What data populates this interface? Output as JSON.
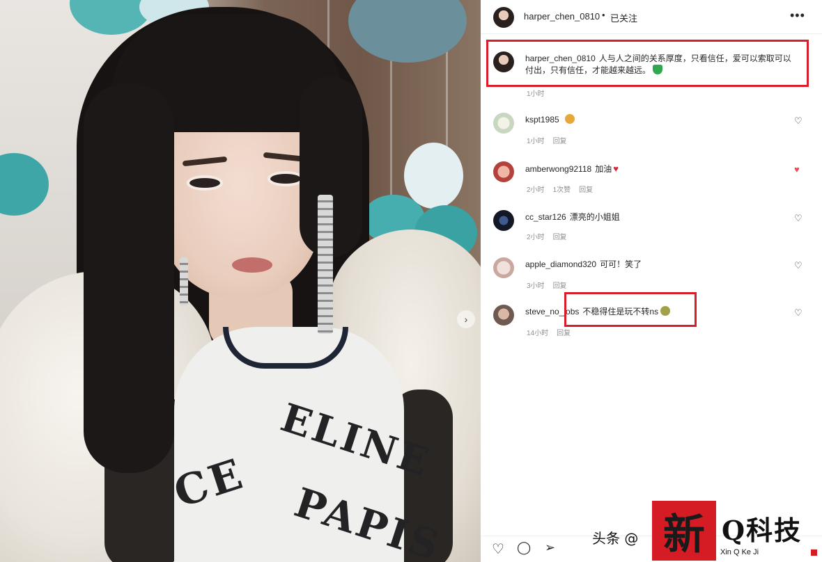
{
  "post": {
    "username": "harper_chen_0810",
    "dot": "•",
    "follow_status": "已关注",
    "more_icon": "more-horizontal-icon",
    "caption_text": "人与人之间的关系厚度，只看信任，爱可以索取可以付出，只有信任，才能越来越远。",
    "caption_time": "1小时"
  },
  "comments": [
    {
      "user": "kspt1985",
      "text": "",
      "emoji": "hugging-face-emoji",
      "meta": [
        "1小时",
        "回复"
      ],
      "liked": false
    },
    {
      "user": "amberwong92118",
      "text": "加油",
      "emoji": "red-heart-emoji",
      "meta": [
        "2小时",
        "1次赞",
        "回复"
      ],
      "liked": true
    },
    {
      "user": "cc_star126",
      "text": "漂亮的小姐姐",
      "emoji": "",
      "meta": [
        "2小时",
        "回复"
      ],
      "liked": false
    },
    {
      "user": "apple_diamond320",
      "text": "可可！笑了",
      "emoji": "",
      "meta": [
        "3小时",
        "回复"
      ],
      "liked": false
    },
    {
      "user": "steve_no_jobs",
      "text": "不稳得住是玩不转ns",
      "emoji": "sick-face-emoji",
      "meta": [
        "14小时",
        "回复"
      ],
      "liked": false
    }
  ],
  "colors": {
    "highlight": "#d81e2a",
    "like_red": "#ed4956",
    "meta_gray": "#8e8e8e",
    "caption_emoji_green": "#2fa84f"
  },
  "actions": {
    "like": "heart-outline-icon",
    "comment": "comment-bubble-icon",
    "share": "paper-plane-icon"
  },
  "watermark": {
    "prefix": "头条 @",
    "seal_char": "新",
    "brand": "Q科技",
    "sub": "Xin Q Ke Ji"
  }
}
